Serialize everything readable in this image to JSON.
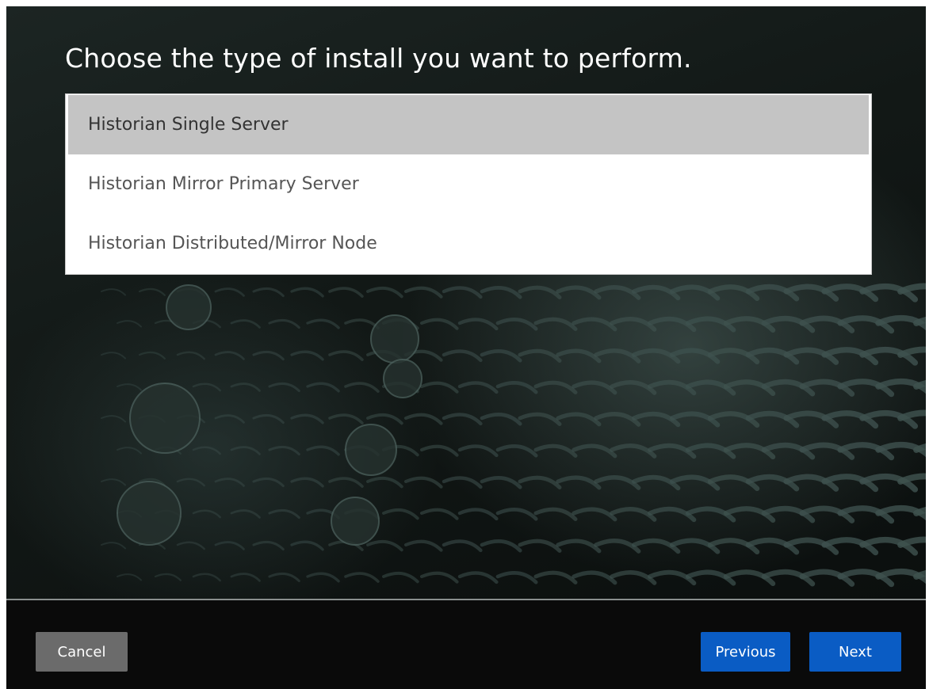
{
  "page": {
    "title": "Choose the type of install you want to perform."
  },
  "install_types": {
    "selected_index": 0,
    "options": [
      {
        "label": "Historian Single Server"
      },
      {
        "label": "Historian Mirror Primary Server"
      },
      {
        "label": "Historian Distributed/Mirror Node"
      }
    ]
  },
  "footer": {
    "cancel_label": "Cancel",
    "previous_label": "Previous",
    "next_label": "Next"
  },
  "colors": {
    "primary_button": "#0a5cc4",
    "cancel_button": "#6b6b6b",
    "selected_row": "#c4c4c4",
    "background": "#0a0a0a"
  },
  "icons": {
    "background_image": "turbine-blades-photo"
  }
}
